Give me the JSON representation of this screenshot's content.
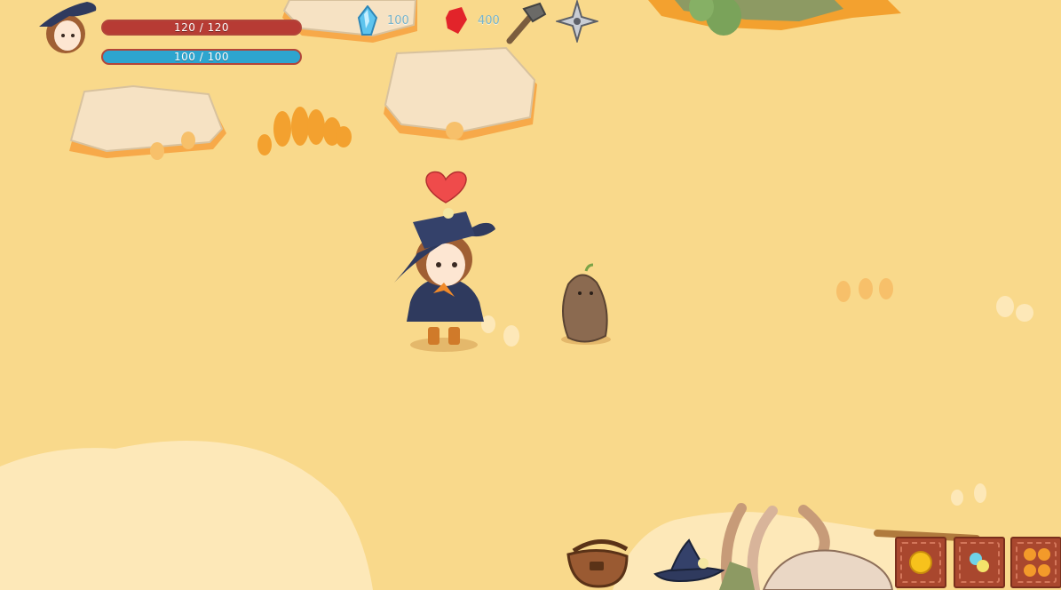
{
  "hud": {
    "health": {
      "text": "120 / 120",
      "current": 120,
      "max": 120,
      "color": "#b73b34"
    },
    "mana": {
      "text": "100 / 100",
      "current": 100,
      "max": 100,
      "color": "#2da5cf"
    },
    "gems": {
      "value": "100",
      "icon": "blue-crystal-icon"
    },
    "rubies": {
      "value": "400",
      "icon": "red-gem-icon"
    },
    "tools": [
      "hammer-icon",
      "shuriken-icon"
    ]
  },
  "hotbar": [
    {
      "icon": "bag-icon"
    },
    {
      "icon": "witch-hat-icon"
    },
    {
      "icon": "sun-orb-icon"
    },
    {
      "icon": "candy-icon"
    },
    {
      "icon": "orange-fruits-icon"
    }
  ],
  "colors": {
    "sand": "#f9d98b",
    "slot": "#a9472e",
    "ui_text": "#77b4cc"
  }
}
